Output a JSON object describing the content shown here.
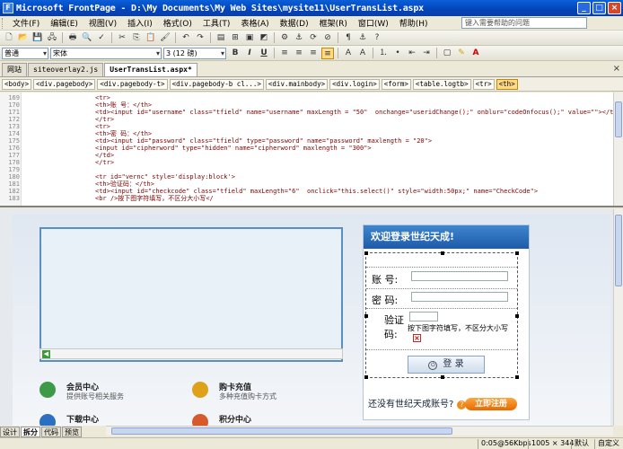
{
  "titlebar": {
    "app_icon": "frontpage-icon",
    "title": "Microsoft FrontPage - D:\\My Documents\\My Web Sites\\mysite11\\UserTransList.aspx"
  },
  "menu": {
    "items": [
      "文件(F)",
      "编辑(E)",
      "视图(V)",
      "插入(I)",
      "格式(O)",
      "工具(T)",
      "表格(A)",
      "数据(D)",
      "框架(R)",
      "窗口(W)",
      "帮助(H)"
    ],
    "help_placeholder": "键入需要帮助的问题"
  },
  "format_toolbar": {
    "style": "普通",
    "font": "宋体",
    "size": "3 (12 磅)",
    "bold": "B",
    "italic": "I",
    "underline": "U"
  },
  "tabs": {
    "items": [
      "网站",
      "siteoverlay2.js",
      "UserTransList.aspx*"
    ],
    "active_index": 2,
    "close": "×"
  },
  "tagpath": [
    "<body>",
    "<div.pagebody>",
    "<div.pagebody-t>",
    "<div.pagebody-b cl...>",
    "<div.mainbody>",
    "<div.login>",
    "<form>",
    "<table.logtb>",
    "<tr>",
    "<th>"
  ],
  "code": {
    "lines": [
      {
        "n": "169",
        "t": "<tr>"
      },
      {
        "n": "170",
        "t": "<th>账 号：</th>"
      },
      {
        "n": "171",
        "t": "<td><input id=\"username\" class=\"tfield\" name=\"username\" maxLength = \"50\"  onchange=\"useridChange();\" onblur=\"codeOnfocus();\" value=\"\"></td>"
      },
      {
        "n": "172",
        "t": "</tr>"
      },
      {
        "n": "173",
        "t": "<tr>"
      },
      {
        "n": "174",
        "t": "<th>密 码：</th>"
      },
      {
        "n": "175",
        "t": "<td><input id=\"password\" class=\"tfield\" type=\"password\" name=\"password\" maxlength = \"20\">"
      },
      {
        "n": "176",
        "t": "<input id=\"cipherword\" type=\"hidden\" name=\"cipherword\" maxlength = \"300\">"
      },
      {
        "n": "177",
        "t": "</td>"
      },
      {
        "n": "178",
        "t": "</tr>"
      },
      {
        "n": "179",
        "t": ""
      },
      {
        "n": "180",
        "t": "<tr id=\"vernc\" style='display:block'>"
      },
      {
        "n": "181",
        "t": "<th>验证码：</th>"
      },
      {
        "n": "182",
        "t": "<td><input id=\"checkcode\" class=\"tfield\" maxLength=\"6\"  onclick=\"this.select()\" style=\"width:50px;\" name=\"CheckCode\">"
      },
      {
        "n": "183",
        "t": "<br />按下图字符填写，不区分大小写</"
      }
    ]
  },
  "design": {
    "login_title": "欢迎登录世纪天成!",
    "account_label": "账 号:",
    "password_label": "密  码:",
    "captcha_label_1": "验证",
    "captcha_label_2": "码:",
    "captcha_hint": "按下图字符填写，不区分大小写",
    "captcha_broken": "×",
    "login_button": "登 录",
    "no_account": "还没有世纪天成账号?",
    "register_button": "立即注册",
    "services": [
      {
        "title": "会员中心",
        "desc": "提供账号相关服务",
        "icon": "members-icon",
        "color": "#3d9a48"
      },
      {
        "title": "购卡充值",
        "desc": "多种充值购卡方式",
        "icon": "coins-icon",
        "color": "#e0a11a"
      },
      {
        "title": "下载中心",
        "desc": "",
        "icon": "download-icon",
        "color": "#2a6fc0"
      },
      {
        "title": "积分中心",
        "desc": "",
        "icon": "chart-icon",
        "color": "#d75a2a"
      }
    ]
  },
  "viewtabs": [
    "设计",
    "拆分",
    "代码",
    "预览"
  ],
  "viewtabs_active": 1,
  "status": {
    "download": "0:05@56Kbps",
    "size": "1005 × 344",
    "default": "默认",
    "custom": "自定义"
  }
}
